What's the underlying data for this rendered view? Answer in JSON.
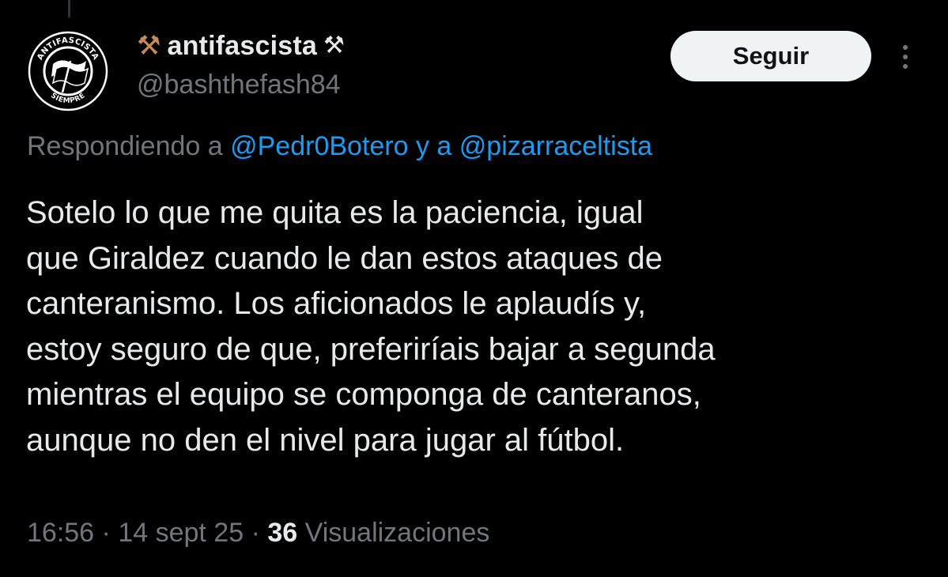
{
  "user": {
    "display_name": "antifascista",
    "prefix_emoji": "⚒",
    "suffix_emoji": "⚒",
    "handle": "@bashthefash84",
    "avatar": {
      "icon": "antifa-flag-logo-icon",
      "top_text": "ANTIFASCISTA",
      "bottom_text": "SIEMPRE",
      "colors": {
        "background": "#000000",
        "ring": "#ffffff"
      }
    }
  },
  "actions": {
    "follow_label": "Seguir",
    "more_icon": "more-vertical-icon"
  },
  "reply": {
    "prefix": "Respondiendo a",
    "mention_1": "@Pedr0Botero",
    "connector": "y a",
    "mention_2": "@pizarraceltista"
  },
  "tweet": {
    "text": "Sotelo lo que me quita es la paciencia, igual\nque Giraldez cuando le dan estos ataques de\ncanteranismo. Los aficionados le aplaudís y,\nestoy seguro de que, preferiríais bajar a segunda\nmientras el equipo se componga de canteranos,\naunque no den el nivel para jugar al fútbol."
  },
  "meta": {
    "time": "16:56",
    "separator": "·",
    "date": "14 sept 25",
    "views_count": "36",
    "views_label": "Visualizaciones"
  },
  "colors": {
    "background": "#000000",
    "text_primary": "#e7e9ea",
    "text_secondary": "#71767b",
    "link": "#1d9bf0",
    "button_bg": "#eff3f4",
    "button_text": "#0f1419"
  }
}
